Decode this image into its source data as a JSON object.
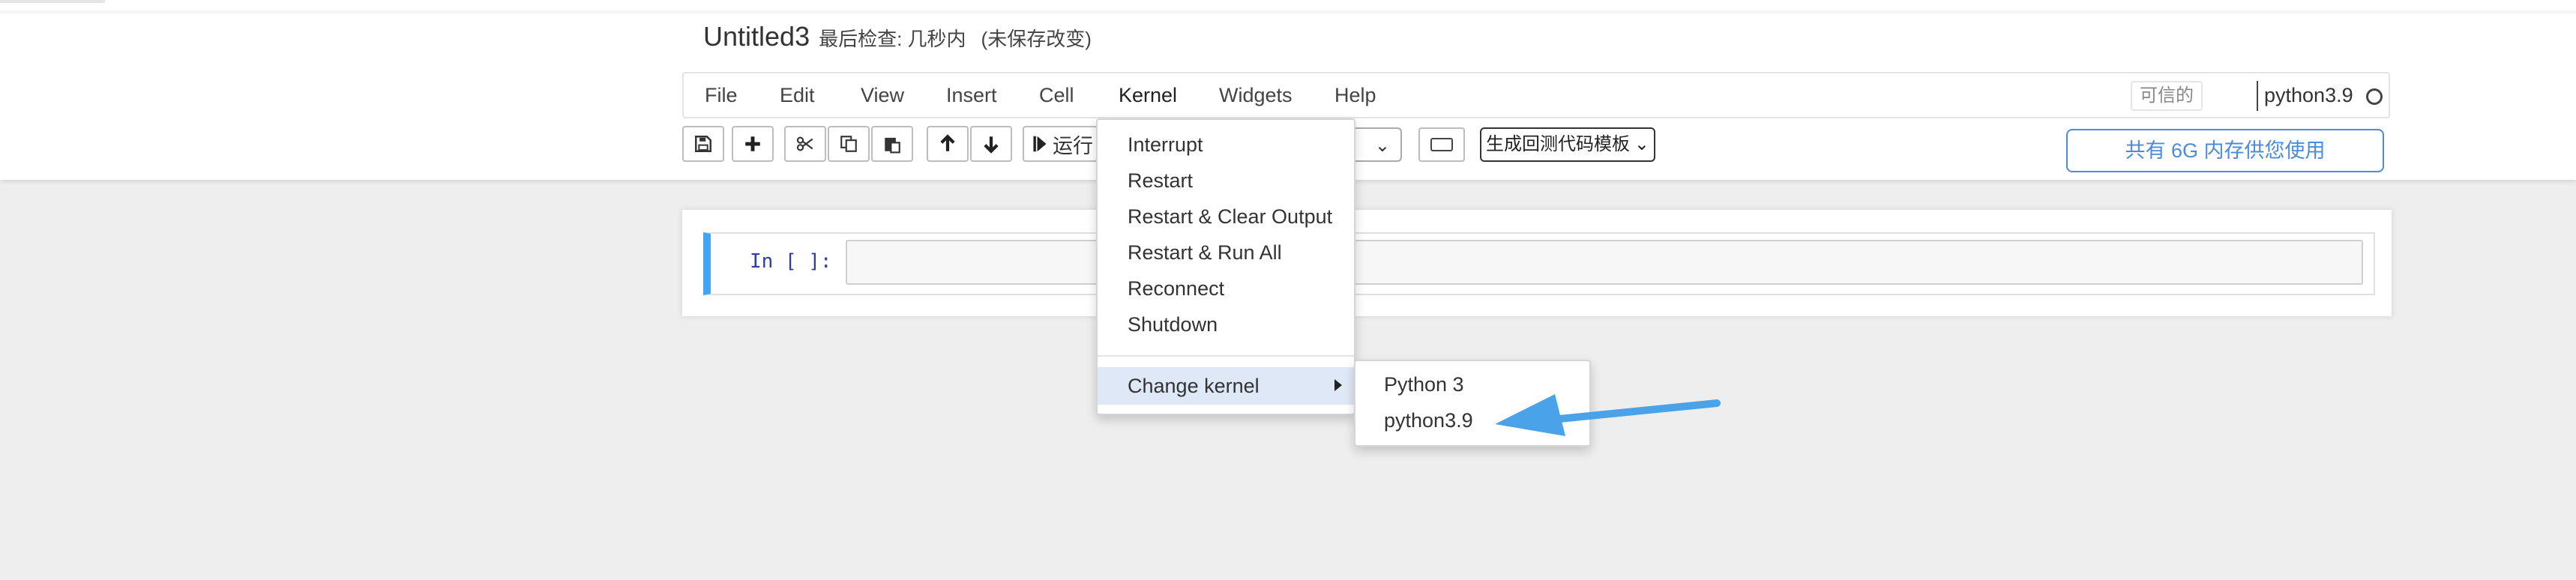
{
  "header": {
    "notebook_name": "Untitled3",
    "checkpoint": "最后检查: 几秒内",
    "autosave_status": "(未保存改变)"
  },
  "menubar": {
    "items": [
      "File",
      "Edit",
      "View",
      "Insert",
      "Cell",
      "Kernel",
      "Widgets",
      "Help"
    ],
    "trusted": "可信的",
    "kernel_name": "python3.9",
    "kernel_indicator_icon": "circle-outline-icon"
  },
  "toolbar": {
    "run_label": "运行",
    "template_select": "生成回测代码模板",
    "icons": [
      "save-icon",
      "plus-icon",
      "cut-icon",
      "copy-icon",
      "paste-icon",
      "arrow-up-icon",
      "arrow-down-icon",
      "run-icon",
      "keyboard-icon"
    ],
    "memory_banner": "共有 6G 内存供您使用"
  },
  "cell": {
    "prompt": "In [ ]:"
  },
  "kernel_menu": {
    "items": [
      "Interrupt",
      "Restart",
      "Restart & Clear Output",
      "Restart & Run All",
      "Reconnect",
      "Shutdown"
    ],
    "change_kernel": "Change kernel",
    "kernels": [
      "Python 3",
      "python3.9"
    ]
  },
  "colors": {
    "accent": "#4a8cdb",
    "cell_selected": "#42a5f5",
    "annotation_arrow": "#4aa3e8",
    "submenu_highlight": "#dfe8f6"
  }
}
